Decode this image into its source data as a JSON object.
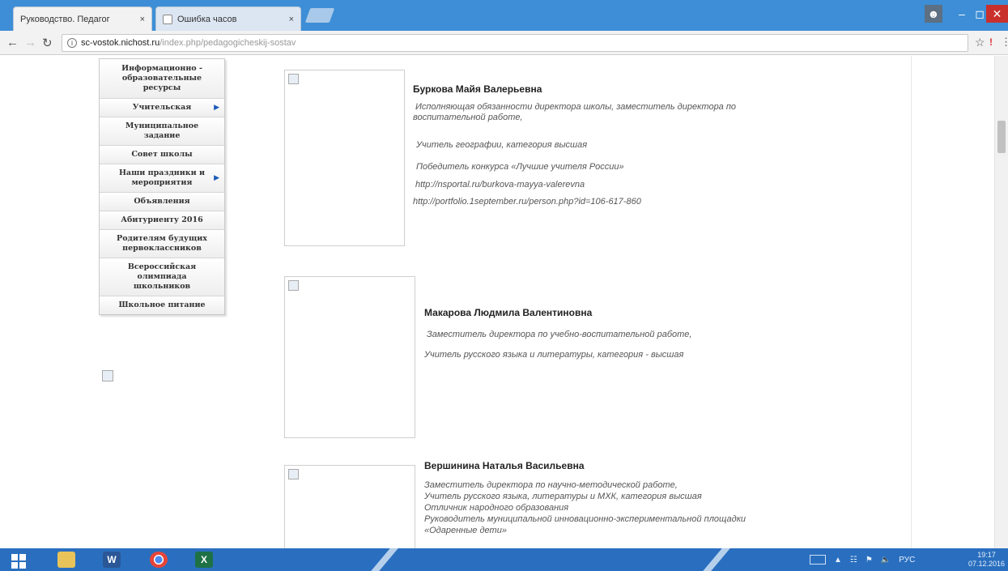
{
  "browser": {
    "tabs": [
      {
        "title": "Руководство. Педагог",
        "active": true
      },
      {
        "title": "Ошибка часов",
        "active": false
      }
    ],
    "close_glyph": "×",
    "url_host": "sc-vostok.nichost.ru",
    "url_path": "/index.php/pedagogicheskij-sostav",
    "icons": [
      "back-arrow-icon",
      "forward-arrow-icon",
      "reload-icon",
      "info-icon",
      "star-icon",
      "extension-icon",
      "menu-icon"
    ]
  },
  "sidebar": {
    "items": [
      {
        "label": "Информационно - образовательные ресурсы",
        "has_submenu": false
      },
      {
        "label": "Учительская",
        "has_submenu": true
      },
      {
        "label": "Муниципальное задание",
        "has_submenu": false
      },
      {
        "label": "Совет школы",
        "has_submenu": false
      },
      {
        "label": "Наши праздники и мероприятия",
        "has_submenu": true
      },
      {
        "label": "Объявления",
        "has_submenu": false
      },
      {
        "label": "Абитуриенту 2016",
        "has_submenu": false
      },
      {
        "label": "Родителям будущих первоклассников",
        "has_submenu": false
      },
      {
        "label": "Всероссийская олимпиада школьников",
        "has_submenu": false
      },
      {
        "label": "Школьное питание",
        "has_submenu": false
      }
    ]
  },
  "people": [
    {
      "name": "Буркова Майя Валерьевна",
      "lines": [
        "Исполняющая обязанности директора школы, заместитель директора по",
        "воспитательной работе,",
        "Учитель географии, категория высшая",
        "Победитель  конкурса «Лучшие учителя России»",
        "http://nsportal.ru/burkova-mayya-valerevna",
        "http://portfolio.1september.ru/person.php?id=106-617-860"
      ]
    },
    {
      "name": "Макарова Людмила Валентиновна",
      "lines": [
        "Заместитель директора по учебно-воспитательной работе,",
        "Учитель русского языка и литературы, категория - высшая"
      ]
    },
    {
      "name": "Вершинина Наталья Васильевна",
      "lines": [
        "Заместитель директора по научно-методической работе,",
        "Учитель русского языка, литературы и МХК, категория высшая",
        "Отличник народного образования",
        "Руководитель муниципальной инновационно-экспериментальной площадки",
        "«Одаренные дети»"
      ]
    }
  ],
  "taskbar": {
    "apps": [
      "windows-start-icon",
      "file-explorer-icon",
      "word-icon",
      "chrome-icon",
      "excel-icon"
    ],
    "word_letter": "W",
    "excel_letter": "X",
    "lang": "РУС",
    "time": "19:17",
    "date": "07.12.2016",
    "colors": {
      "taskbar": "#2a6fbf",
      "titlebar": "#3d8ed6",
      "close": "#c9302c"
    }
  }
}
